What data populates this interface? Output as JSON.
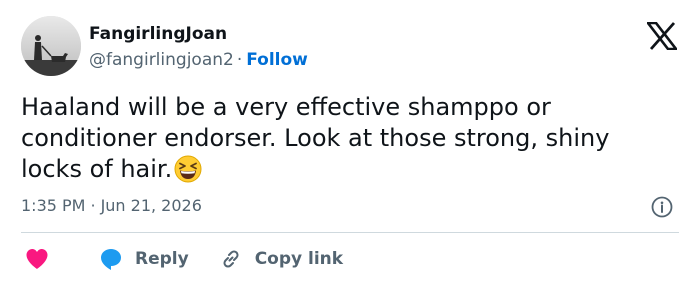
{
  "author": {
    "display_name": "FangirlingJoan",
    "handle": "@fangirlingjoan2",
    "separator": "·",
    "follow_label": "Follow"
  },
  "platform_logo": "x-logo-icon",
  "tweet": {
    "lines": [
      "Haaland will be a very effective shamppo or",
      "conditioner endorser. Look at those strong, shiny",
      "locks of hair."
    ],
    "emoji": "grinning-squinting-face-emoji"
  },
  "meta": {
    "time": "1:35 PM",
    "separator": "·",
    "date": "Jun 21, 2026",
    "info_icon": "info-icon"
  },
  "actions": {
    "like_icon": "heart-icon",
    "reply_label": "Reply",
    "copy_label": "Copy link"
  },
  "colors": {
    "text_primary": "#0f1419",
    "text_secondary": "#536471",
    "link_blue": "#006fd6",
    "heart_red": "#f91880",
    "reply_blue": "#1d9bf0",
    "divider": "#cfd9de"
  }
}
